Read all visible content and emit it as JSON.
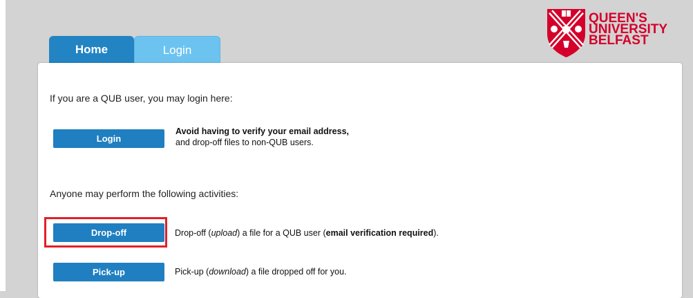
{
  "tabs": [
    {
      "label": "Home"
    },
    {
      "label": "Login"
    }
  ],
  "logo": {
    "line1": "QUEEN'S",
    "line2": "UNIVERSITY",
    "line3": "BELFAST",
    "color": "#d4002b"
  },
  "qub_section": {
    "intro": "If you are a QUB user, you may login here:",
    "login_button": "Login",
    "login_desc_bold": "Avoid having to verify your email address,",
    "login_desc_line2": "and drop-off files to non-QUB users."
  },
  "anyone_section": {
    "intro": "Anyone may perform the following activities:",
    "dropoff_button": "Drop-off",
    "dropoff_desc": {
      "a": "Drop-off (",
      "em": "upload",
      "b": ") a file for a QUB user (",
      "strong": "email verification required",
      "c": ")."
    },
    "pickup_button": "Pick-up",
    "pickup_desc": {
      "a": "Pick-up (",
      "em": "download",
      "b": ") a file dropped off for you."
    }
  },
  "colors": {
    "button": "#1f7fc0",
    "tab_active": "#2384c3",
    "tab_light": "#6cc3ef",
    "highlight": "#e21f26"
  }
}
